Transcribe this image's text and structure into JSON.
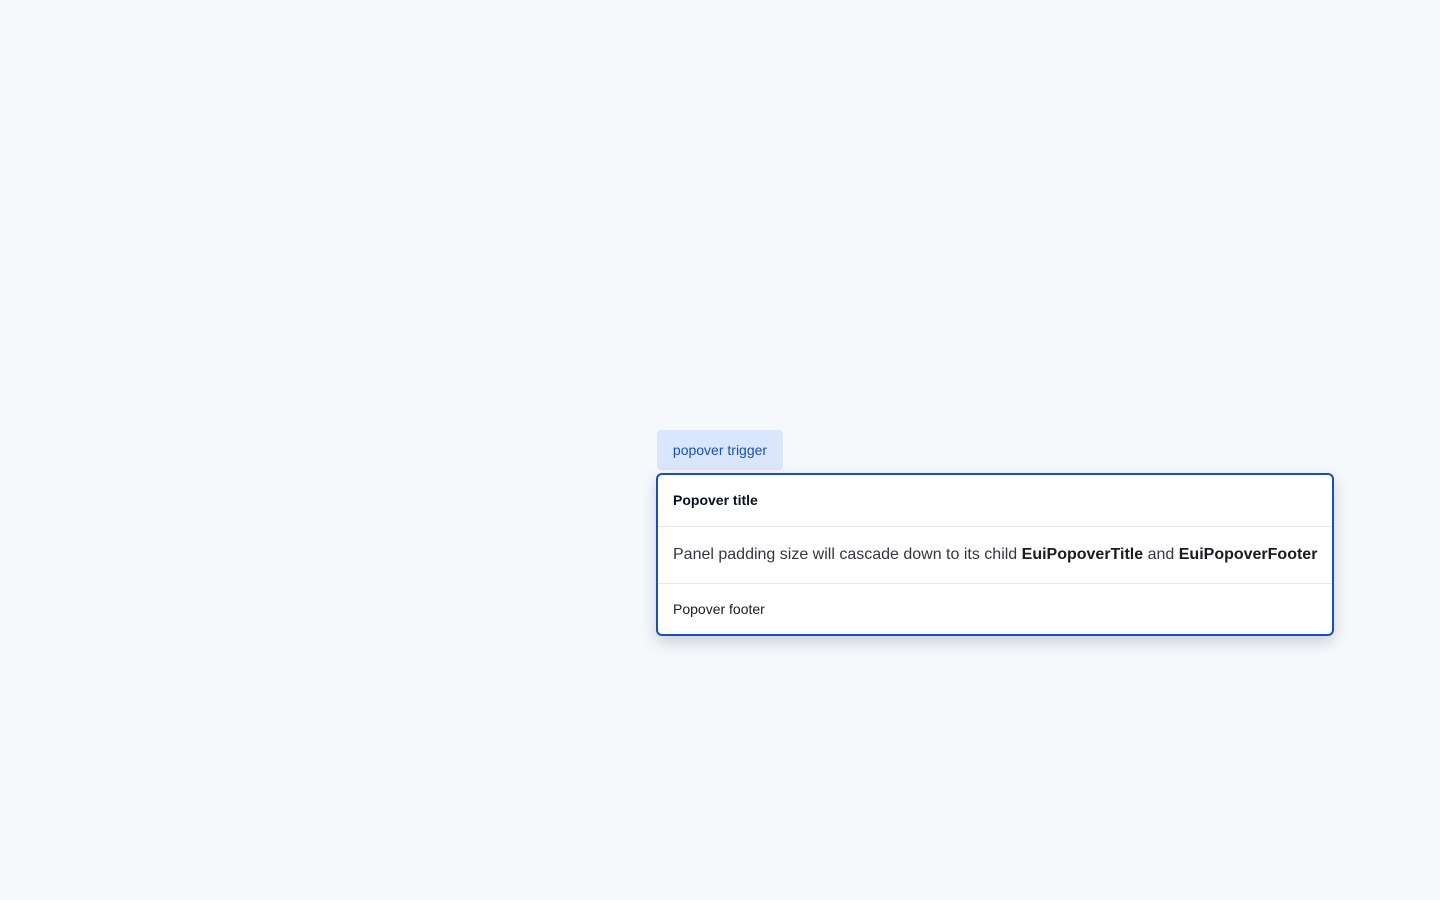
{
  "trigger": {
    "label": "popover trigger"
  },
  "popover": {
    "title": "Popover title",
    "body": {
      "text_before": "Panel padding size will cascade down to its child ",
      "strong_one": "EuiPopoverTitle",
      "text_middle": " and ",
      "strong_two": "EuiPopoverFooter"
    },
    "footer": "Popover footer"
  },
  "colors": {
    "background": "#f6f9fc",
    "accent": "#1750ba",
    "trigger_bg": "#d9e6fb"
  }
}
